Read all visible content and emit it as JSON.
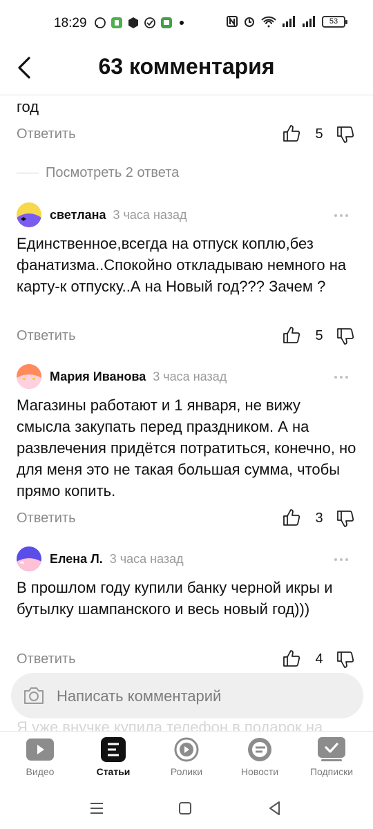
{
  "status_bar": {
    "time": "18:29",
    "battery": "53"
  },
  "header": {
    "title": "63 комментария"
  },
  "comments_prev": {
    "text_tail": "год",
    "reply_label": "Ответить",
    "likes": "5",
    "view_replies": "Посмотреть 2 ответа"
  },
  "comments": [
    {
      "author": "светлана",
      "time": "3 часа назад",
      "text": "Единственное,всегда на отпуск коплю,без фанатизма..Спокойно откладываю немного на карту-к отпуску..А на Новый год??? Зачем ?",
      "reply_label": "Ответить",
      "likes": "5"
    },
    {
      "author": "Мария Иванова",
      "time": "3 часа назад",
      "text": "Магазины работают и 1 января, не вижу смысла закупать перед праздником. А на развлечения придётся потратиться, конечно, но для меня это не такая большая сумма, чтобы прямо копить.",
      "reply_label": "Ответить",
      "likes": "3"
    },
    {
      "author": "Елена Л.",
      "time": "3 часа назад",
      "text": "В прошлом году купили банку черной икры и бутылку шампанского и весь новый год)))",
      "reply_label": "Ответить",
      "likes": "4"
    }
  ],
  "next_comment_peek": "Я уже внучке купила телефон в подарок на",
  "composer": {
    "placeholder": "Написать комментарий"
  },
  "bottom_nav": [
    {
      "label": "Видео",
      "icon": "video-icon"
    },
    {
      "label": "Статьи",
      "icon": "articles-icon"
    },
    {
      "label": "Ролики",
      "icon": "shorts-icon"
    },
    {
      "label": "Новости",
      "icon": "news-icon"
    },
    {
      "label": "Подписки",
      "icon": "subscriptions-icon"
    }
  ],
  "colors": {
    "muted": "#8a8a8a",
    "composer_bg": "#efefef",
    "nav_icon": "#8c8c8c",
    "active": "#111111"
  }
}
